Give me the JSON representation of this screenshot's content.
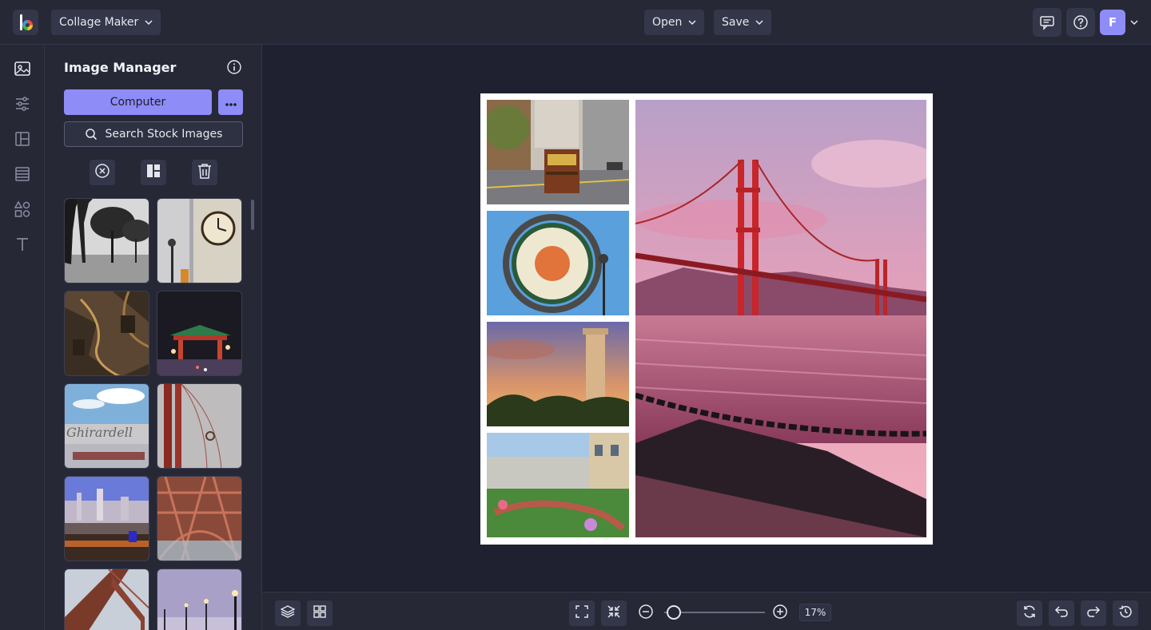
{
  "app": {
    "mode_label": "Collage Maker",
    "open_label": "Open",
    "save_label": "Save",
    "user_initial": "F"
  },
  "rail": {
    "items": [
      "image-icon",
      "sliders-icon",
      "layout-icon",
      "texture-icon",
      "graphics-icon",
      "text-icon"
    ]
  },
  "panel": {
    "title": "Image Manager",
    "computer_label": "Computer",
    "search_stock_label": "Search Stock Images",
    "thumbnails": [
      "Black and white trees with Golden Gate",
      "Ferry building clock tower",
      "Aerial view of winding road at night",
      "Chinatown gate at night",
      "Ghirardelli sign with clouds",
      "Golden Gate tower in fog",
      "City skyline over harbor",
      "Golden Gate bridge red trusses",
      "Golden Gate tower from below",
      "Pier lamps at dusk"
    ]
  },
  "collage": {
    "cells": [
      "Cable car on California Street",
      "Fisherman's Wharf sign",
      "Coit Tower at sunset",
      "Lombard Street view",
      "Golden Gate Bridge at pink sunset"
    ]
  },
  "zoom": {
    "value": "17%",
    "level": 0.17
  },
  "colors": {
    "accent": "#8e8cf6",
    "background": "#1f2130",
    "panel": "#262836"
  }
}
